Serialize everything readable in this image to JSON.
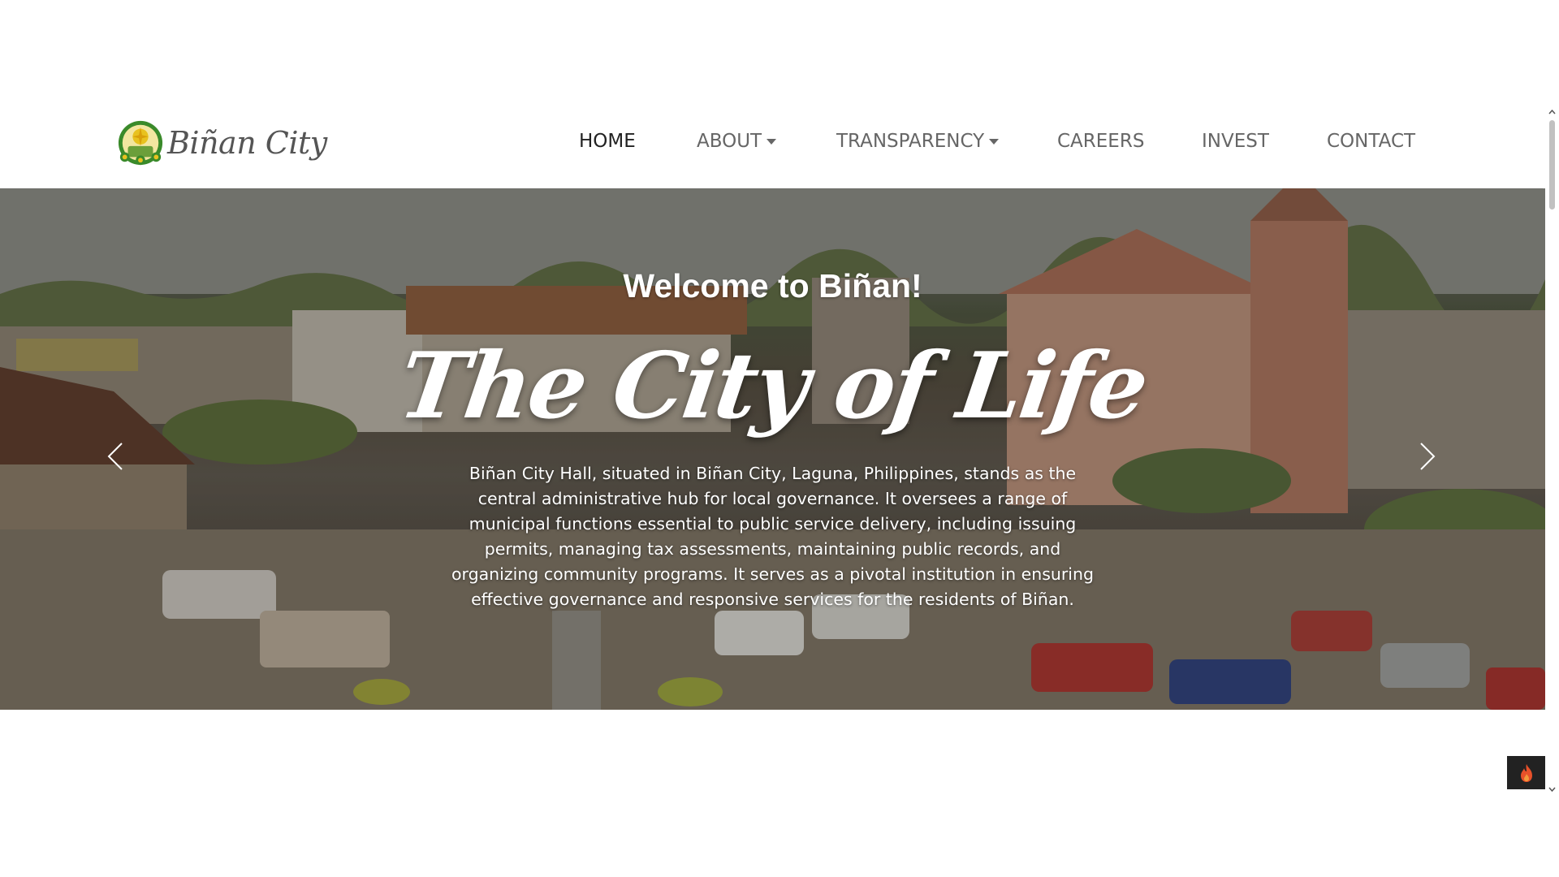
{
  "brand": {
    "name": "Biñan City",
    "seal_icon": "city-seal-icon"
  },
  "nav": {
    "items": [
      {
        "label": "HOME",
        "active": true,
        "dropdown": false
      },
      {
        "label": "ABOUT",
        "active": false,
        "dropdown": true
      },
      {
        "label": "TRANSPARENCY",
        "active": false,
        "dropdown": true
      },
      {
        "label": "CAREERS",
        "active": false,
        "dropdown": false
      },
      {
        "label": "INVEST",
        "active": false,
        "dropdown": false
      },
      {
        "label": "CONTACT",
        "active": false,
        "dropdown": false
      }
    ]
  },
  "hero": {
    "kicker": "Welcome to Biñan!",
    "title": "The City of Life",
    "description": "Biñan City Hall, situated in Biñan City, Laguna, Philippines, stands as the central administrative hub for local governance. It oversees a range of municipal functions essential to public service delivery, including issuing permits, managing tax assessments, maintaining public records, and organizing community programs. It serves as a pivotal institution in ensuring effective governance and responsive services for the residents of Biñan.",
    "prev_icon": "chevron-left-icon",
    "next_icon": "chevron-right-icon"
  },
  "widget": {
    "icon": "fire-icon",
    "color": "#e8512a"
  },
  "colors": {
    "nav_active": "#222222",
    "nav_text": "#666666",
    "seal_green": "#3a8a2a",
    "seal_yellow": "#e8c21f"
  }
}
